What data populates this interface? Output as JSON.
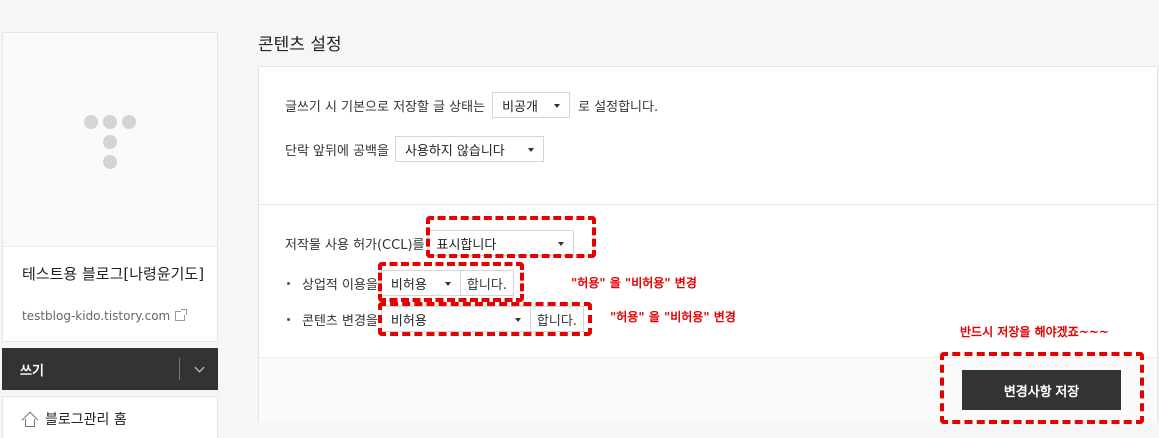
{
  "sidebar": {
    "blog_name": "테스트용 블로그[나령윤기도]",
    "blog_url": "testblog-kido.tistory.com",
    "write_label": "쓰기",
    "home_label": "블로그관리 홈"
  },
  "main": {
    "title": "콘텐츠 설정",
    "default_status": {
      "prefix": "글쓰기 시 기본으로 저장할 글 상태는",
      "value": "비공개",
      "suffix": "로 설정합니다."
    },
    "paragraph_spacing": {
      "label": "단락 앞뒤에 공백을",
      "value": "사용하지 않습니다"
    },
    "ccl": {
      "label": "저작물 사용 허가(CCL)를",
      "value": "표시합니다",
      "commercial_label": "상업적 이용을",
      "commercial_value": "비허용",
      "commercial_suffix": "합니다.",
      "modify_label": "콘텐츠 변경을",
      "modify_value": "비허용",
      "modify_suffix": "합니다."
    },
    "save_label": "변경사항 저장"
  },
  "annotations": {
    "note1": "\"허용\" 을 \"비허용\" 변경",
    "note2": "\"허용\" 을 \"비허용\" 변경",
    "note3": "반드시 저장을 해야겠죠~~~",
    "color": "#e60000"
  }
}
